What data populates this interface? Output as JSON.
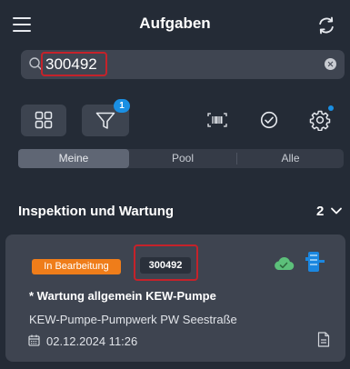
{
  "header": {
    "title": "Aufgaben",
    "menu_icon": "hamburger-icon",
    "sync_icon": "sync-icon"
  },
  "search": {
    "value": "300492",
    "placeholder": ""
  },
  "toolbar": {
    "filter_badge": "1",
    "icons": [
      "grid-icon",
      "filter-icon",
      "barcode-icon",
      "check-circle-icon",
      "gear-icon"
    ]
  },
  "segments": [
    {
      "label": "Meine",
      "active": true
    },
    {
      "label": "Pool",
      "active": false
    },
    {
      "label": "Alle",
      "active": false
    }
  ],
  "section": {
    "title": "Inspektion und Wartung",
    "count": "2"
  },
  "card": {
    "status": "In Bearbeitung",
    "id": "300492",
    "title": "* Wartung allgemein KEW-Pumpe",
    "subtitle": "KEW-Pumpe-Pumpwerk PW Seestraße",
    "date": "02.12.2024 11:26"
  },
  "colors": {
    "background": "#242b36",
    "status_orange": "#ef7d1a",
    "badge_blue": "#1a8fe3",
    "highlight_red": "#c5222a",
    "cloud_green": "#5cc07a"
  }
}
